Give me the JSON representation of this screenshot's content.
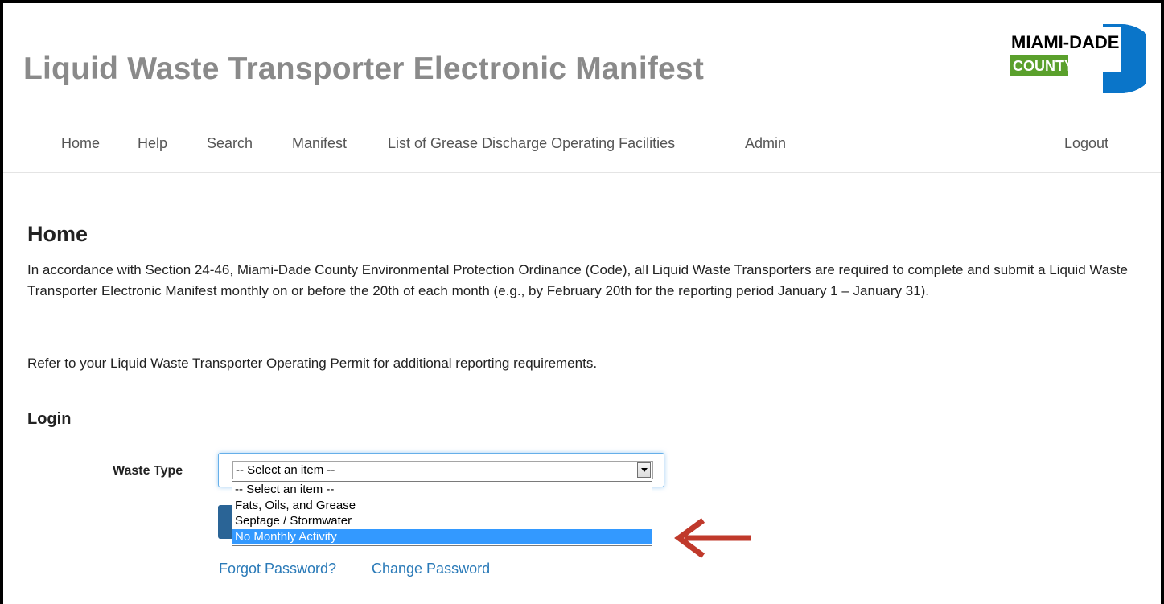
{
  "header": {
    "title": "Liquid Waste Transporter Electronic Manifest",
    "logo": {
      "line1": "MIAMI-DADE",
      "line2": "COUNTY",
      "brand_blue": "#0a75c9",
      "brand_green": "#5aa02c"
    }
  },
  "nav": {
    "items": [
      {
        "label": "Home"
      },
      {
        "label": "Help"
      },
      {
        "label": "Search"
      },
      {
        "label": "Manifest"
      },
      {
        "label": "List of Grease Discharge Operating Facilities"
      },
      {
        "label": "Admin"
      }
    ],
    "logout": "Logout"
  },
  "main": {
    "title": "Home",
    "paragraph1": "In accordance with Section 24-46, Miami-Dade County Environmental Protection Ordinance (Code), all Liquid Waste Transporters are required to complete and submit a Liquid Waste Transporter Electronic Manifest monthly on or before the 20th of each month (e.g., by February 20th for the reporting period January 1 – January 31).",
    "paragraph2": "Refer to your Liquid Waste Transporter Operating Permit for additional reporting requirements."
  },
  "login": {
    "title": "Login",
    "waste_type_label": "Waste Type",
    "waste_type_value": "-- Select an item --",
    "options": [
      "-- Select an item --",
      "Fats, Oils, and Grease",
      "Septage / Stormwater",
      "No Monthly Activity"
    ],
    "highlighted_option": "No Monthly Activity",
    "forgot_password": "Forgot Password?",
    "change_password": "Change Password"
  },
  "colors": {
    "accent": "#2a6496",
    "link": "#2a7ab8",
    "highlight": "#3399ff",
    "annotation_arrow": "#c0392b"
  }
}
